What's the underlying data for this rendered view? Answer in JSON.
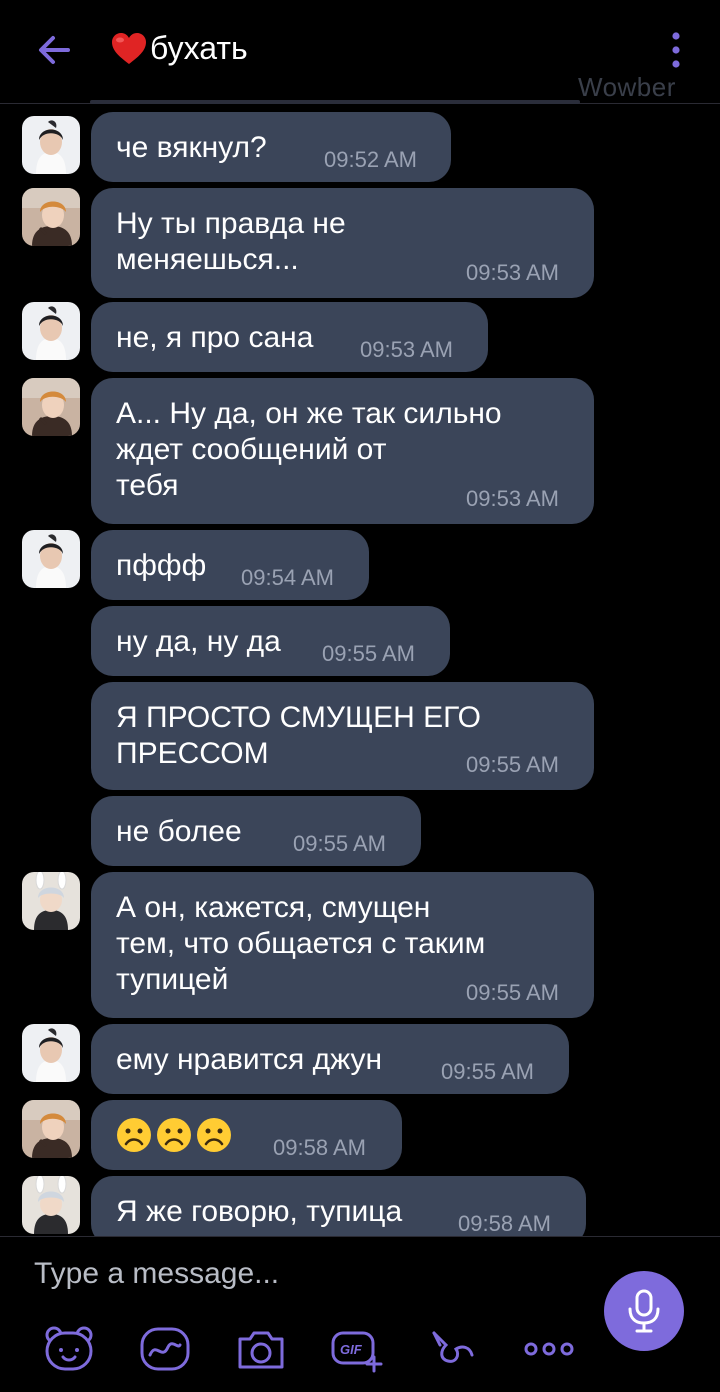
{
  "header": {
    "title": "бухать",
    "watermark": "Wowber"
  },
  "messages": [
    {
      "avatar": "avatar-a",
      "text": "че вякнул?",
      "time": "09:52 AM"
    },
    {
      "avatar": "avatar-b",
      "text": "Ну ты правда не\nменяешься...",
      "time": "09:53 AM"
    },
    {
      "avatar": "avatar-a",
      "text": "не, я про сана",
      "time": "09:53 AM"
    },
    {
      "avatar": "avatar-b",
      "text": "А... Ну да, он же так сильно\nждет сообщений от\nтебя",
      "time": "09:53 AM"
    },
    {
      "avatar": "avatar-a",
      "text": "пффф",
      "time": "09:54 AM"
    },
    {
      "avatar": "",
      "text": "ну да, ну да",
      "time": "09:55 AM"
    },
    {
      "avatar": "",
      "text": "Я ПРОСТО СМУЩЕН ЕГО\nПРЕССОМ",
      "time": "09:55 AM"
    },
    {
      "avatar": "",
      "text": "не более",
      "time": "09:55 AM"
    },
    {
      "avatar": "avatar-c",
      "text": "А он, кажется, смущен\nтем, что общается с таким\nтупицей",
      "time": "09:55 AM"
    },
    {
      "avatar": "avatar-a",
      "text": "ему нравится джун",
      "time": "09:55 AM"
    },
    {
      "avatar": "avatar-b",
      "text": "☹☹☹",
      "time": "09:58 AM"
    },
    {
      "avatar": "avatar-c",
      "text": "Я же говорю, тупица",
      "time": "09:58 AM"
    }
  ],
  "composer": {
    "placeholder": "Type a message..."
  },
  "colors": {
    "bubble": "#3b4559",
    "accent": "#7e6bdc",
    "background": "#000000",
    "timestamp": "#9aa2b3"
  },
  "icons": {
    "back": "arrow-left-icon",
    "menu": "kebab-menu-icon",
    "heart": "red-heart-emoji",
    "mic": "microphone-icon",
    "toolbar": [
      "bear-sticker-icon",
      "doodle-icon",
      "camera-icon",
      "gif-icon",
      "tag-icon",
      "more-icon"
    ]
  }
}
